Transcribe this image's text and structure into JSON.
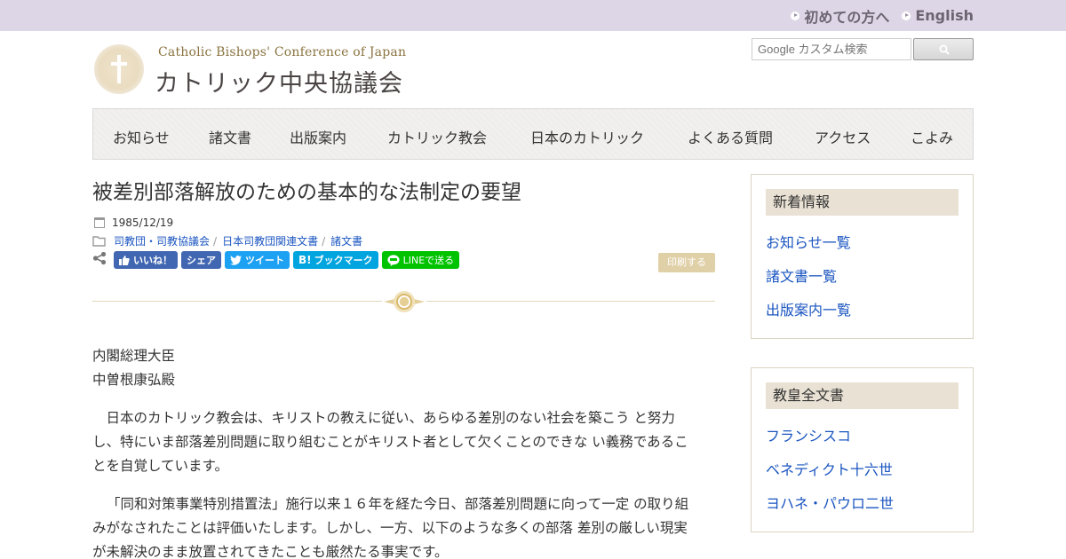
{
  "topbar": {
    "links": [
      "初めての方へ",
      "English"
    ]
  },
  "header": {
    "logo_en": "Catholic Bishops' Conference of Japan",
    "logo_ja": "カトリック中央協議会",
    "search_placeholder": "Google カスタム検索"
  },
  "nav": {
    "items": [
      "お知らせ",
      "諸文書",
      "出版案内",
      "カトリック教会",
      "日本のカトリック",
      "よくある質問",
      "アクセス",
      "こよみ"
    ]
  },
  "article": {
    "title": "被差別部落解放のための基本的な法制定の要望",
    "date": "1985/12/19",
    "categories": [
      "司教団・司教協議会",
      "日本司教団関連文書",
      "諸文書"
    ],
    "share": {
      "like": "いいね！",
      "share": "シェア",
      "tweet": "ツイート",
      "bookmark": "ブックマーク",
      "line": "LINEで送る"
    },
    "print_label": "印刷する",
    "addressee_1": "内閣総理大臣",
    "addressee_2": "中曽根康弘殿",
    "para1_l1": "　日本のカトリック教会は、キリストの教えに従い、あらゆる差別のない社会を築こう と努力",
    "para1_l2": "し、特にいま部落差別問題に取り組むことがキリスト者として欠くことのできな い義務であるこ",
    "para1_l3": "とを自覚しています。",
    "para2_l1": "「同和対策事業特別措置法」施行以来１６年を経た今日、部落差別問題に向って一定 の取り組",
    "para2_l2": "みがなされたことは評価いたします。しかし、一方、以下のような多くの部落 差別の厳しい現実",
    "para2_l3": "が未解決のまま放置されてきたことも厳然たる事実です。"
  },
  "sidebar": {
    "news": {
      "heading": "新着情報",
      "links": [
        "お知らせ一覧",
        "諸文書一覧",
        "出版案内一覧"
      ]
    },
    "popes": {
      "heading": "教皇全文書",
      "links": [
        "フランシスコ",
        "ベネディクト十六世",
        "ヨハネ・パウロ二世"
      ]
    }
  }
}
